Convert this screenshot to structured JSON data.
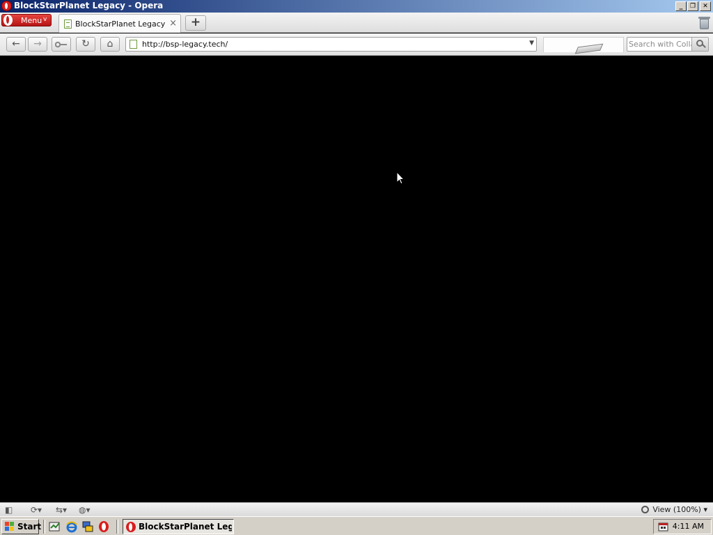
{
  "window": {
    "title": "BlockStarPlanet Legacy - Opera",
    "minimize_glyph": "_",
    "maximize_glyph": "❐",
    "close_glyph": "✕"
  },
  "tabbar": {
    "menu_label": "Menu",
    "menu_chevron": "v",
    "tabs": [
      {
        "label": "BlockStarPlanet Legacy",
        "close_glyph": "×"
      }
    ],
    "new_tab_glyph": "+"
  },
  "navbar": {
    "back_glyph": "←",
    "forward_glyph": "→",
    "reload_glyph": "↻",
    "home_glyph": "⌂",
    "url": "http://bsp-legacy.tech/",
    "dropdown_glyph": "▼",
    "search_placeholder": "Search with Collab"
  },
  "page": {
    "background": "#000000"
  },
  "statusbar": {
    "panel_glyph": "◧",
    "sync_glyph": "⟳▾",
    "share_glyph": "⇆▾",
    "turbo_glyph": "◍▾",
    "view_label": "View (100%)",
    "view_chevron": "▾"
  },
  "taskbar": {
    "start_label": "Start",
    "task_label": "BlockStarPlanet Lega...",
    "clock": "4:11 AM"
  },
  "colors": {
    "title_gradient_start": "#0a246a",
    "title_gradient_end": "#a6caf0",
    "opera_red": "#d81e1e",
    "taskbar_gray": "#d4d0c8"
  }
}
